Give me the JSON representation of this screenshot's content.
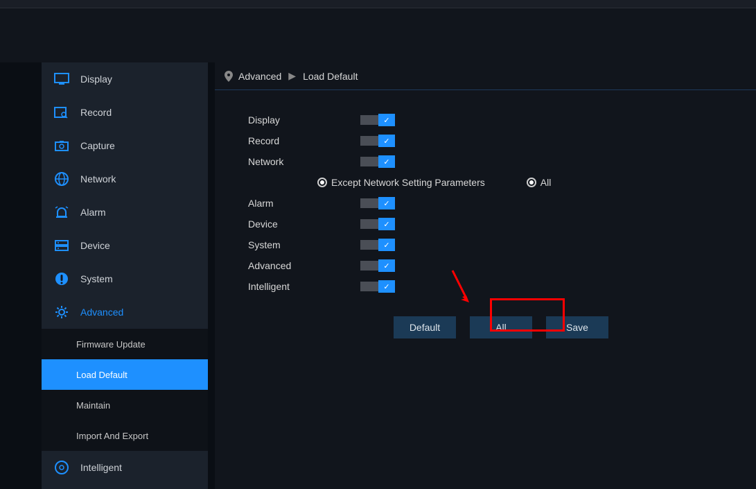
{
  "sidebar": {
    "items": [
      {
        "label": "Display"
      },
      {
        "label": "Record"
      },
      {
        "label": "Capture"
      },
      {
        "label": "Network"
      },
      {
        "label": "Alarm"
      },
      {
        "label": "Device"
      },
      {
        "label": "System"
      },
      {
        "label": "Advanced"
      },
      {
        "label": "Intelligent"
      }
    ],
    "advanced_sub": [
      {
        "label": "Firmware Update"
      },
      {
        "label": "Load Default"
      },
      {
        "label": "Maintain"
      },
      {
        "label": "Import And Export"
      }
    ]
  },
  "breadcrumb": {
    "item1": "Advanced",
    "item2": "Load Default"
  },
  "settings": {
    "rows": [
      {
        "label": "Display"
      },
      {
        "label": "Record"
      },
      {
        "label": "Network"
      },
      {
        "label": "Alarm"
      },
      {
        "label": "Device"
      },
      {
        "label": "System"
      },
      {
        "label": "Advanced"
      },
      {
        "label": "Intelligent"
      }
    ],
    "radio": {
      "option1": "Except Network Setting Parameters",
      "option2": "All"
    },
    "buttons": {
      "default": "Default",
      "all": "All",
      "save": "Save"
    }
  }
}
